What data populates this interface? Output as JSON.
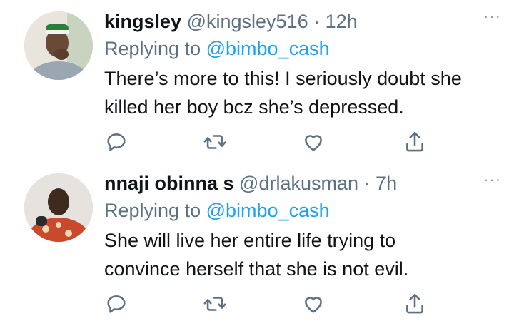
{
  "tweets": [
    {
      "name": "kingsley",
      "handle": "@kingsley516",
      "separator": "·",
      "time": "12h",
      "replying_prefix": "Replying to",
      "replying_to": "@bimbo_cash",
      "text_line1": "There’s more to this! I seriously doubt she",
      "text_line2": "killed her boy bcz she’s depressed.",
      "more": "···"
    },
    {
      "name": "nnaji obinna s",
      "handle": "@drlakusman",
      "separator": "·",
      "time": "7h",
      "replying_prefix": "Replying to",
      "replying_to": "@bimbo_cash",
      "text_line1": "She will live her entire life trying to",
      "text_line2": "convince herself that she is not evil.",
      "more": "···"
    }
  ],
  "icons": {
    "reply": "reply-icon",
    "retweet": "retweet-icon",
    "like": "heart-icon",
    "share": "share-icon"
  },
  "colors": {
    "text": "#0f1419",
    "secondary": "#5b7083",
    "link": "#1da1f2",
    "divider": "#e1e6ea",
    "icon": "#5b7083"
  }
}
